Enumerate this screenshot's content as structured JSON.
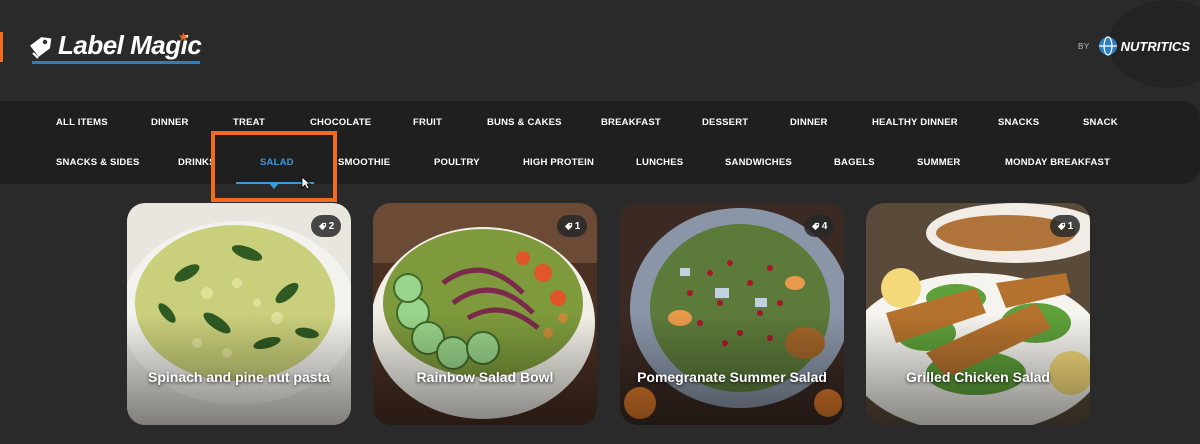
{
  "brand": {
    "logo_text": "Label Magic",
    "by_label": "BY",
    "partner_name": "NUTRITICS"
  },
  "nav": {
    "row1": [
      "ALL ITEMS",
      "DINNER",
      "TREAT",
      "CHOCOLATE",
      "FRUIT",
      "BUNS & CAKES",
      "BREAKFAST",
      "DESSERT",
      "DINNER",
      "HEALTHY DINNER",
      "SNACKS",
      "SNACK"
    ],
    "row2": [
      "SNACKS & SIDES",
      "DRINKS",
      "SALAD",
      "SMOOTHIE",
      "POULTRY",
      "HIGH PROTEIN",
      "LUNCHES",
      "SANDWICHES",
      "BAGELS",
      "SUMMER",
      "MONDAY BREAKFAST"
    ],
    "active": "SALAD"
  },
  "cards": [
    {
      "title": "Spinach and pine nut pasta",
      "count": "2"
    },
    {
      "title": "Rainbow Salad Bowl",
      "count": "1"
    },
    {
      "title": "Pomegranate Summer Salad",
      "count": "4"
    },
    {
      "title": "Grilled Chicken Salad",
      "count": "1"
    }
  ],
  "colors": {
    "accent": "#3a9ad9",
    "highlight": "#f26b21",
    "background": "#2a2a2a"
  }
}
